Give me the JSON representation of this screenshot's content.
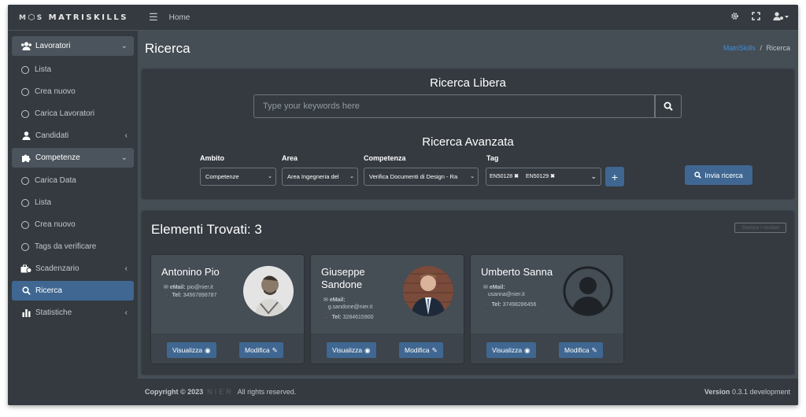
{
  "brand": {
    "logo_m": "M",
    "logo_s": "S",
    "logo_text": "MATRISKILLS"
  },
  "header": {
    "menu_icon": "hamburger-icon",
    "home": "Home"
  },
  "sidebar": {
    "items": [
      {
        "label": "Lavoratori",
        "icon": "users-icon"
      },
      {
        "label": "Lista"
      },
      {
        "label": "Crea nuovo"
      },
      {
        "label": "Carica Lavoratori"
      },
      {
        "label": "Candidati",
        "icon": "user-tie-icon"
      },
      {
        "label": "Competenze",
        "icon": "puzzle-icon"
      },
      {
        "label": "Carica Data"
      },
      {
        "label": "Lista"
      },
      {
        "label": "Crea nuovo"
      },
      {
        "label": "Tags da verificare"
      },
      {
        "label": "Scadenzario",
        "icon": "briefcase-clock-icon"
      },
      {
        "label": "Ricerca",
        "icon": "search-icon"
      },
      {
        "label": "Statistiche",
        "icon": "bar-chart-icon"
      }
    ]
  },
  "page": {
    "title": "Ricerca",
    "breadcrumb_root": "MatriSkills",
    "breadcrumb_sep": "/",
    "breadcrumb_current": "Ricerca"
  },
  "search": {
    "free_title": "Ricerca Libera",
    "placeholder": "Type your keywords here",
    "advanced_title": "Ricerca Avanzata",
    "labels": {
      "ambito": "Ambito",
      "area": "Area",
      "competenza": "Competenza",
      "tag": "Tag"
    },
    "values": {
      "ambito": "Competenze",
      "area": "Area Ingegneria del",
      "competenza": "Verifica Documenti di Design - Ra"
    },
    "tags": [
      "EN50128",
      "EN50129"
    ],
    "submit_label": "Invia ricerca"
  },
  "results": {
    "title": "Elementi Trovati: 3",
    "print_label": "Stampa i risultati",
    "email_label": "eMail:",
    "tel_label": "Tel:",
    "view_label": "Visualizza",
    "edit_label": "Modifica",
    "people": [
      {
        "name": "Antonino Pio",
        "email": "pio@nier.it",
        "tel": "34567898787"
      },
      {
        "name": "Giuseppe Sandone",
        "email": "g.sandone@nier.it",
        "tel": "3284615900"
      },
      {
        "name": "Umberto Sanna",
        "email": "usanna@nier.it",
        "tel": "37498286456"
      }
    ]
  },
  "footer": {
    "copyright": "Copyright © 2023",
    "company": "NIER",
    "rights": "All rights reserved.",
    "version_label": "Version",
    "version": "0.3.1 development"
  }
}
